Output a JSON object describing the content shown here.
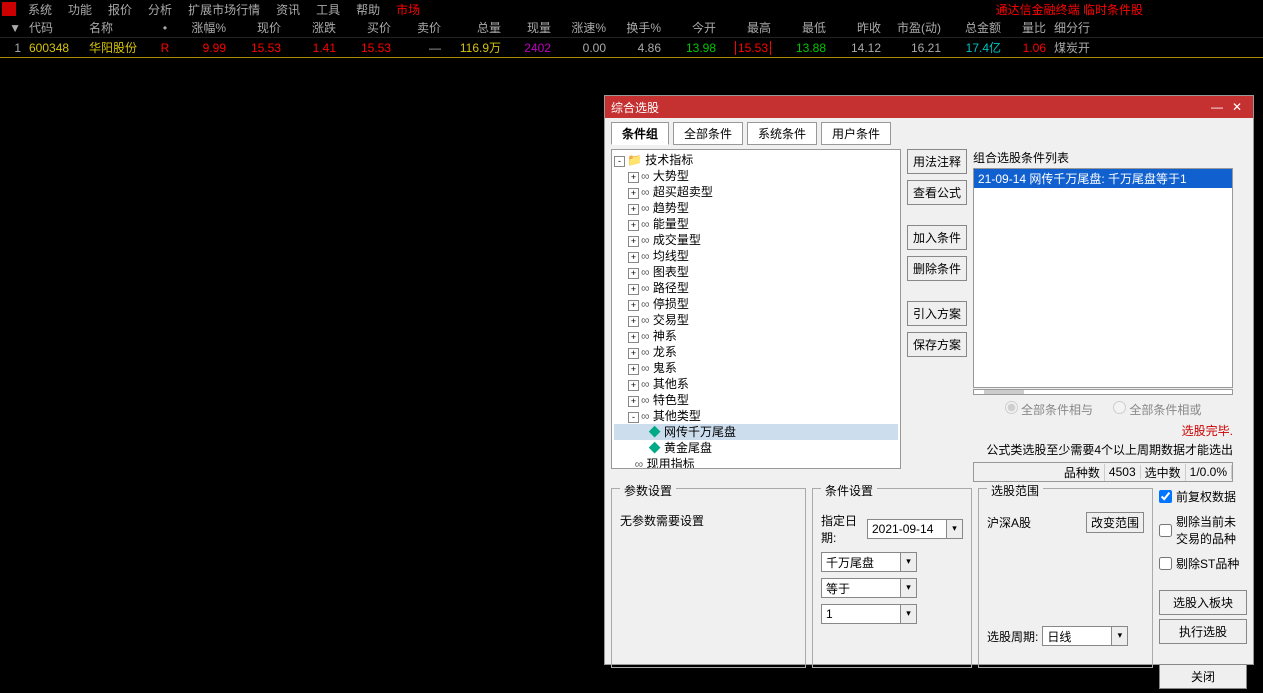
{
  "menubar": {
    "items": [
      "系统",
      "功能",
      "报价",
      "分析",
      "扩展市场行情",
      "资讯",
      "工具",
      "帮助"
    ],
    "active": "市场",
    "title": "通达信金融终端 临时条件股"
  },
  "table": {
    "headers": [
      "",
      "代码",
      "名称",
      "",
      "涨幅%",
      "现价",
      "涨跌",
      "买价",
      "卖价",
      "总量",
      "现量",
      "涨速%",
      "换手%",
      "今开",
      "最高",
      "最低",
      "昨收",
      "市盈(动)",
      "总金额",
      "量比",
      "细分行"
    ],
    "row": {
      "idx": "1",
      "code": "600348",
      "name": "华阳股份",
      "mark": "R",
      "pct": "9.99",
      "price": "15.53",
      "diff": "1.41",
      "buy": "15.53",
      "sell": "—",
      "vol": "116.9万",
      "now": "2402",
      "speed": "0.00",
      "turn": "4.86",
      "open": "13.98",
      "high": "15.53",
      "low": "13.88",
      "close": "14.12",
      "pe": "16.21",
      "amt": "17.4亿",
      "ratio": "1.06",
      "ind": "煤炭开"
    }
  },
  "dialog": {
    "title": "综合选股",
    "tabs": [
      "条件组",
      "全部条件",
      "系统条件",
      "用户条件"
    ],
    "active_tab": "条件组",
    "tree": {
      "root": "技术指标",
      "groups": [
        "大势型",
        "超买超卖型",
        "趋势型",
        "能量型",
        "成交量型",
        "均线型",
        "图表型",
        "路径型",
        "停损型",
        "交易型",
        "神系",
        "龙系",
        "鬼系",
        "其他系",
        "特色型"
      ],
      "open_group": "其他类型",
      "leaves": [
        "网传千万尾盘",
        "黄金尾盘"
      ],
      "after": "现用指标"
    },
    "buttons": {
      "usage": "用法注释",
      "view": "查看公式",
      "add": "加入条件",
      "del": "删除条件",
      "import": "引入方案",
      "save": "保存方案"
    },
    "right": {
      "label": "组合选股条件列表",
      "item": "21-09-14 网传千万尾盘: 千万尾盘等于1",
      "radio_and": "全部条件相与",
      "radio_or": "全部条件相或",
      "status": "选股完毕.",
      "info": "公式类选股至少需要4个以上周期数据才能选出",
      "count_label": "品种数",
      "count_val": "4503",
      "sel_label": "选中数",
      "sel_val": "1/0.0%"
    },
    "param": {
      "legend": "参数设置",
      "text": "无参数需要设置"
    },
    "cond": {
      "legend": "条件设置",
      "date_label": "指定日期:",
      "date_val": "2021-09-14",
      "field1": "千万尾盘",
      "op": "等于",
      "val": "1"
    },
    "scope": {
      "legend": "选股范围",
      "market": "沪深A股",
      "change_btn": "改变范围",
      "period_label": "选股周期:",
      "period_val": "日线"
    },
    "checks": {
      "fq": "前复权数据",
      "excl_nt": "剔除当前未\n交易的品种",
      "excl_st": "剔除ST品种",
      "to_block": "选股入板块",
      "run": "执行选股",
      "close": "关闭"
    }
  }
}
